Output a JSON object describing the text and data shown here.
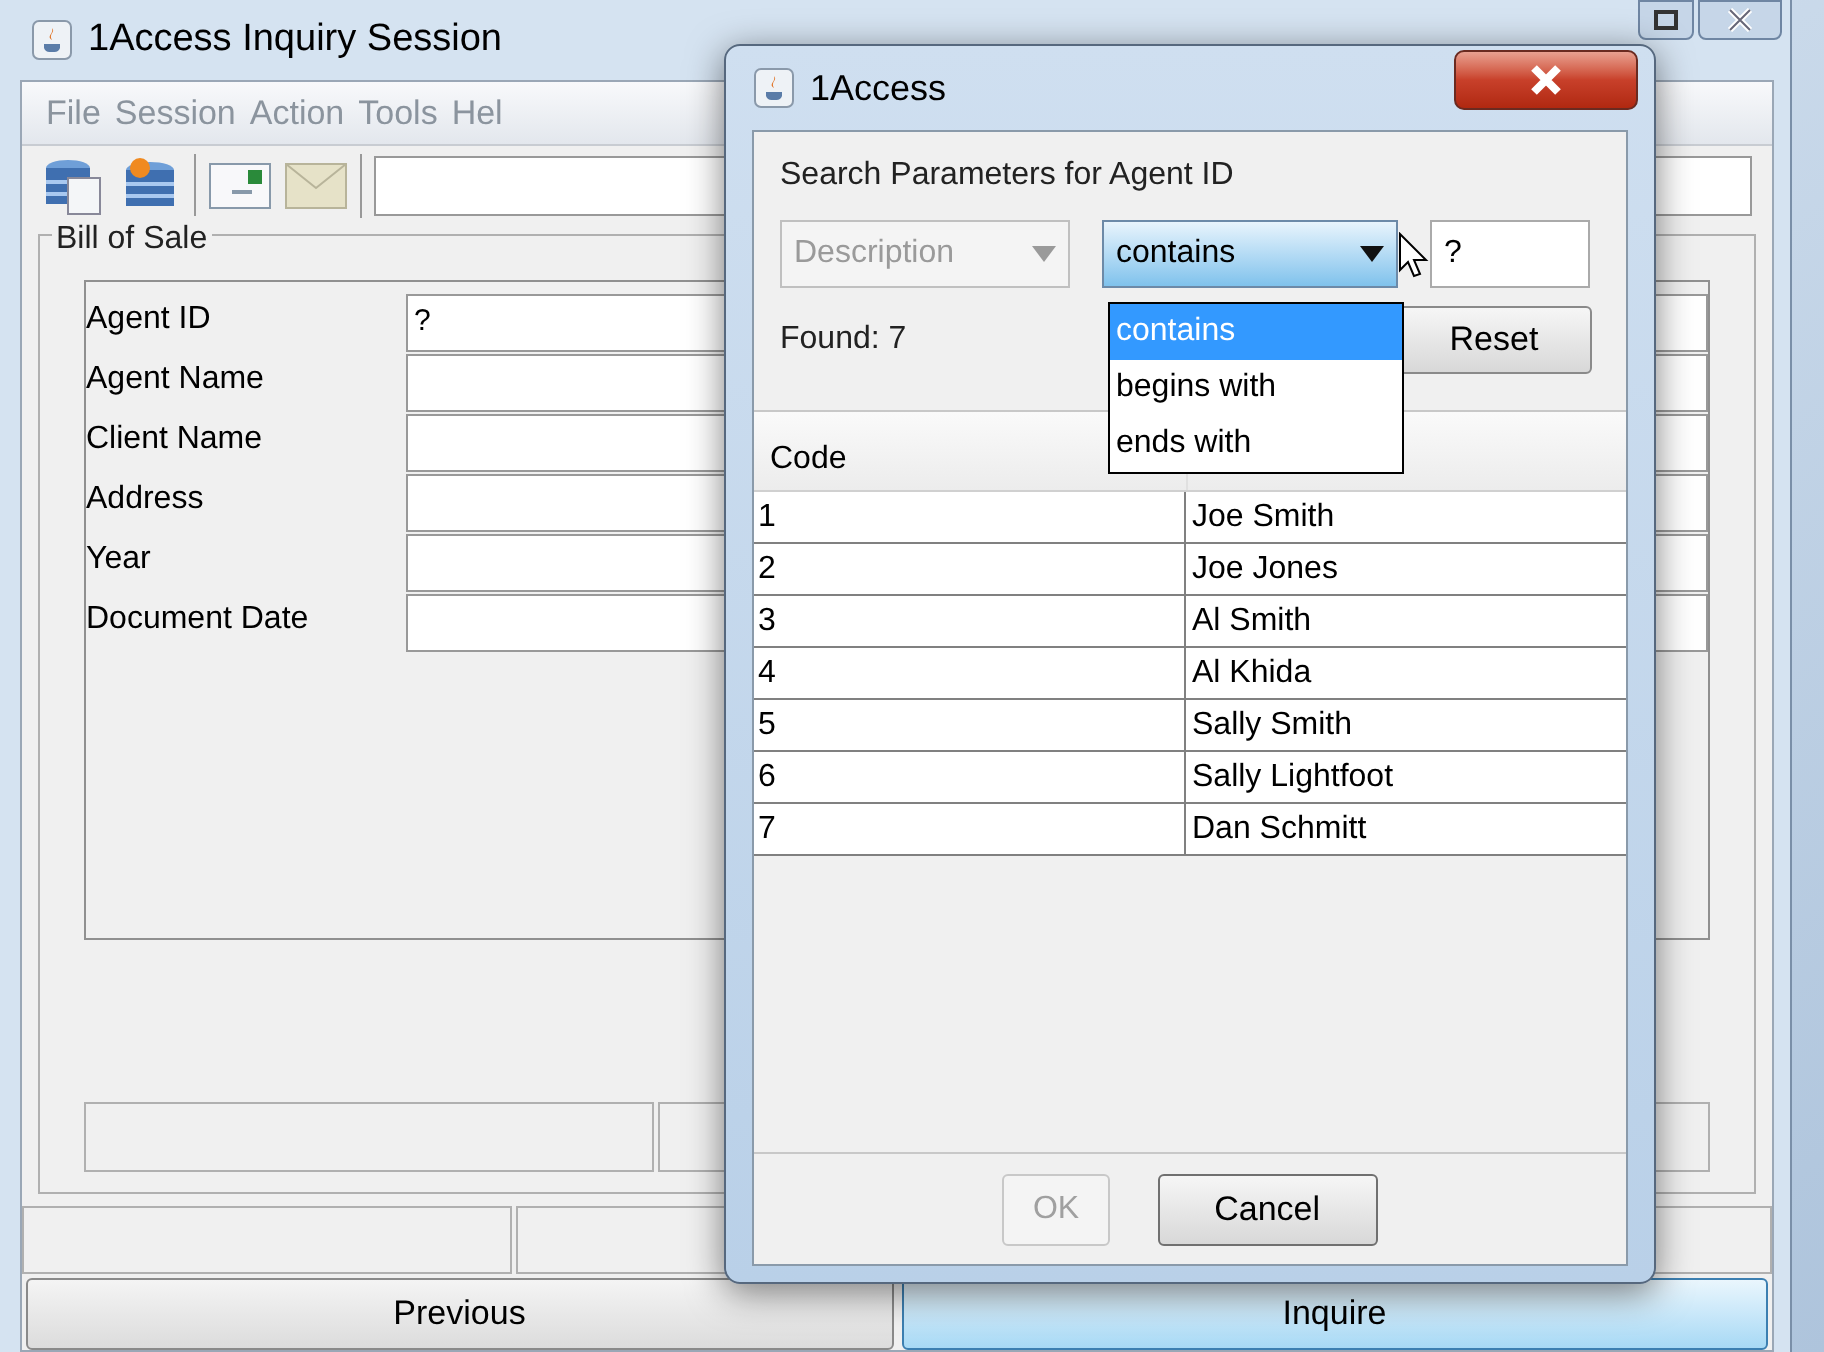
{
  "main_window": {
    "title": "1Access Inquiry Session",
    "menu": [
      "File",
      "Session",
      "Action",
      "Tools",
      "Hel"
    ],
    "group_title": "Bill of Sale",
    "fields": [
      {
        "label": "Agent ID",
        "value": "?"
      },
      {
        "label": "Agent Name"
      },
      {
        "label": "Client Name"
      },
      {
        "label": "Address"
      },
      {
        "label": "Year"
      },
      {
        "label": "Document Date"
      }
    ],
    "buttons": [
      {
        "label": "Previous",
        "selected": false
      },
      {
        "label": "Inquire",
        "selected": true
      }
    ]
  },
  "dialog": {
    "title": "1Access",
    "group_title": "Search Parameters for Agent ID",
    "field_combo": {
      "value": "Description",
      "disabled": true
    },
    "operator_combo": {
      "value": "contains",
      "expanded": true,
      "options": [
        {
          "label": "contains",
          "selected": true
        },
        {
          "label": "begins with",
          "selected": false
        },
        {
          "label": "ends with",
          "selected": false
        }
      ]
    },
    "search_value": "?",
    "found": "Found: 7",
    "reset": "Reset",
    "table": {
      "columns": [
        "Code"
      ],
      "rows": [
        [
          "1",
          "Joe Smith"
        ],
        [
          "2",
          "Joe Jones"
        ],
        [
          "3",
          "Al Smith"
        ],
        [
          "4",
          "Al Khida"
        ],
        [
          "5",
          "Sally Smith"
        ],
        [
          "6",
          "Sally Lightfoot"
        ],
        [
          "7",
          "Dan Schmitt"
        ]
      ]
    },
    "buttons": [
      {
        "label": "OK",
        "disabled": true
      },
      {
        "label": "Cancel",
        "disabled": false
      }
    ]
  }
}
